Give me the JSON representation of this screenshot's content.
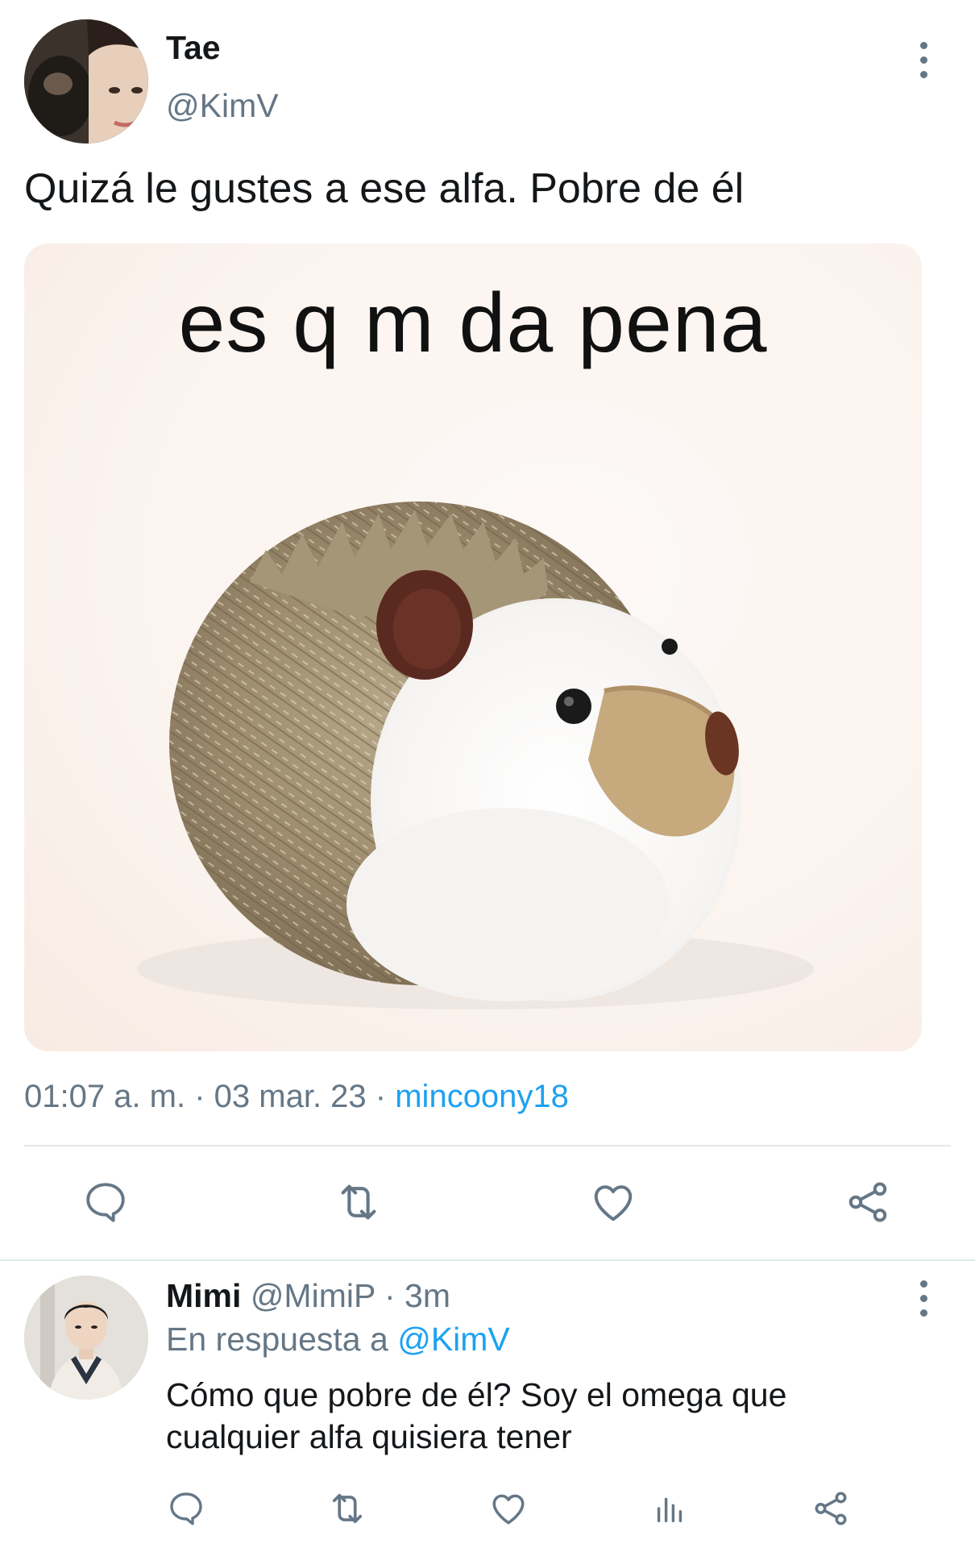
{
  "tweet": {
    "author_name": "Tae",
    "author_handle": "@KimV",
    "text": "Quizá le gustes a ese alfa. Pobre de él",
    "media_caption": "es q m da pena",
    "time": "01:07 a. m.",
    "separator": " · ",
    "date": "03 mar. 23",
    "source": "mincoony18"
  },
  "actions": {
    "reply_icon": "reply-icon",
    "retweet_icon": "retweet-icon",
    "like_icon": "heart-icon",
    "share_icon": "share-icon"
  },
  "reply": {
    "author_name": "Mimi",
    "author_handle": "@MimiP",
    "age": "3m",
    "in_reply_label": "En respuesta a",
    "in_reply_handle": "@KimV",
    "text_line1": "Cómo que pobre de él? Soy el omega que",
    "text_line2": "cualquier alfa quisiera tener"
  },
  "colors": {
    "text": "#14171a",
    "secondary": "#657786",
    "link": "#1da1f2",
    "divider": "#e1e8ed"
  }
}
